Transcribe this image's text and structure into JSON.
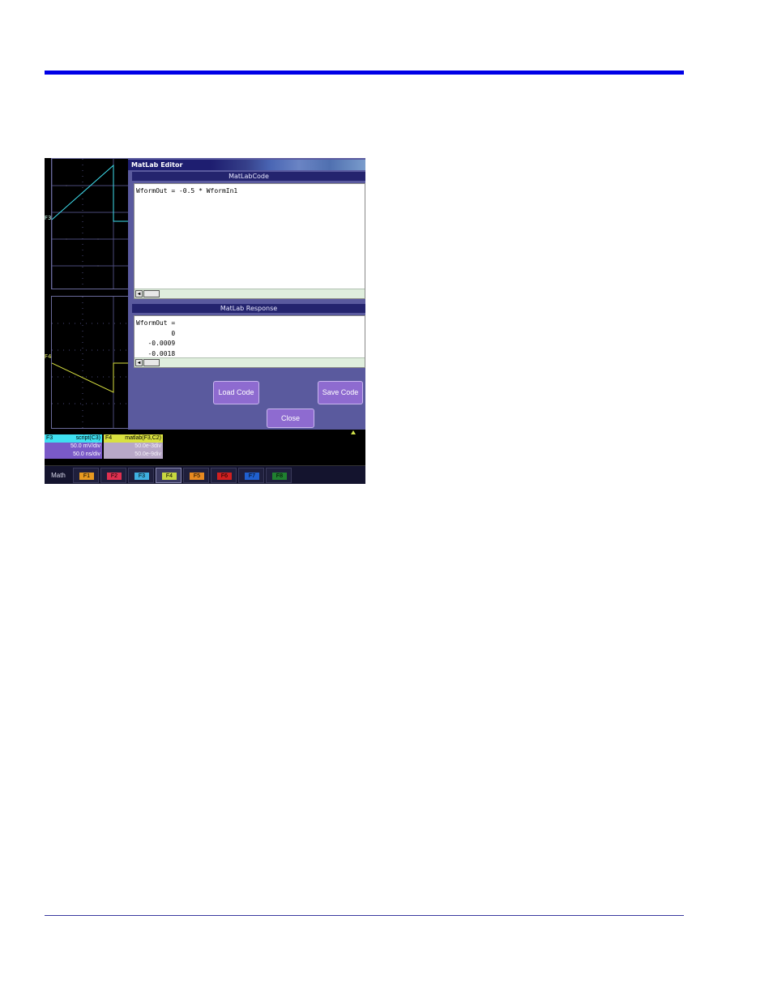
{
  "page": {
    "accent_color": "#0000e6"
  },
  "editor": {
    "title": "MatLab Editor",
    "code_header": "MatLabCode",
    "code_text": "WformOut = -0.5 * WformIn1",
    "response_header": "MatLab Response",
    "response_lines": [
      "WformOut =",
      "         0",
      "   -0.0009",
      "   -0.0018"
    ],
    "load_button": "Load Code",
    "save_button": "Save Code",
    "close_button": "Close"
  },
  "traces": {
    "f3_tag": "F3",
    "f4_tag": "F4",
    "f3_color": "#3fe0f0",
    "f4_color": "#d8e040"
  },
  "channels": [
    {
      "id": "F3",
      "name": "script(C3)",
      "vdiv": "50.0 mV/div",
      "tdiv": "50.0 ns/div",
      "head_color": "#3fe0f0",
      "body_color": "#7a5ac8"
    },
    {
      "id": "F4",
      "name": "matlab(F3,C2)",
      "vdiv": "50.0e-3div",
      "tdiv": "50.0e-9div",
      "head_color": "#d8e040",
      "body_color": "#b8a8c8"
    }
  ],
  "tabbar": {
    "math_label": "Math",
    "tabs": [
      {
        "label": "F1",
        "color": "#e89a20"
      },
      {
        "label": "F2",
        "color": "#e03050"
      },
      {
        "label": "F3",
        "color": "#3fb0e0"
      },
      {
        "label": "F4",
        "color": "#c8d840"
      },
      {
        "label": "F5",
        "color": "#e88a20"
      },
      {
        "label": "F6",
        "color": "#d02020"
      },
      {
        "label": "F7",
        "color": "#2060d0"
      },
      {
        "label": "F8",
        "color": "#208030"
      }
    ]
  }
}
